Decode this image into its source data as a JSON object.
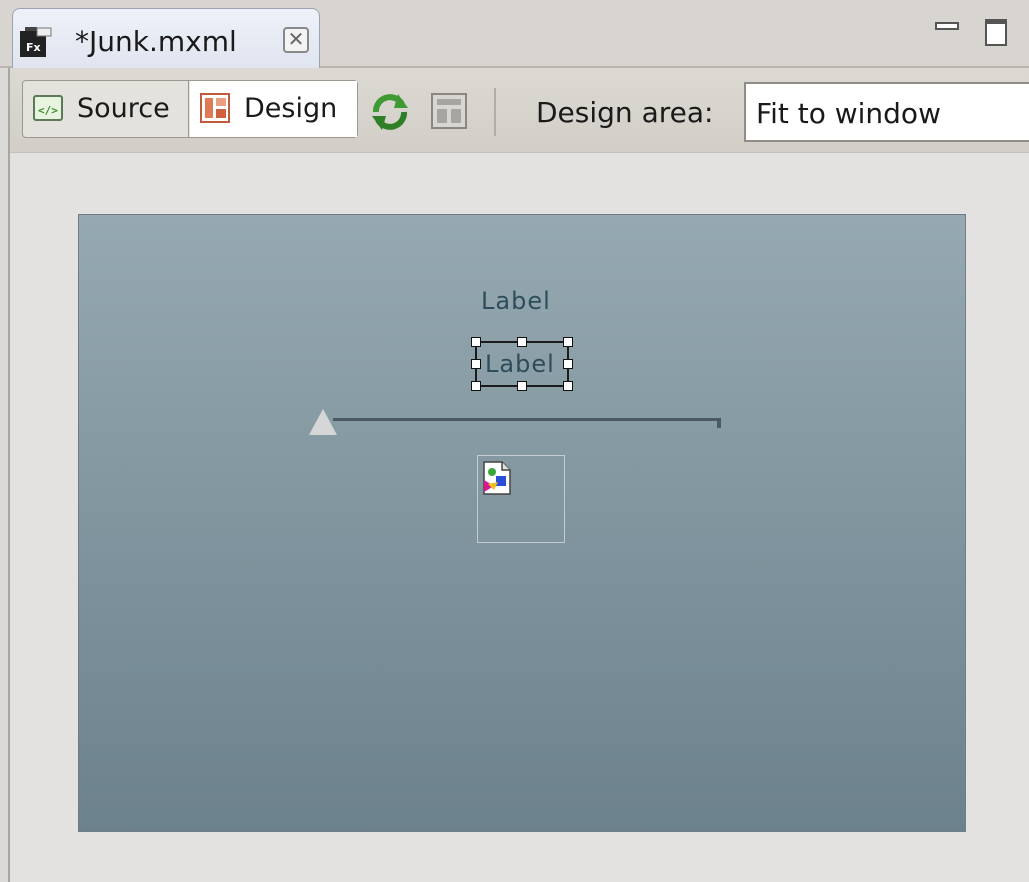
{
  "editor_tab": {
    "title": "*Junk.mxml",
    "icon": "fx-file-icon",
    "close_icon": "close-icon"
  },
  "window_controls": {
    "minimize_icon": "minimize-icon",
    "maximize_icon": "maximize-icon"
  },
  "toolbar": {
    "source_label": "Source",
    "design_label": "Design",
    "active_mode": "Design",
    "refresh_icon": "refresh-icon",
    "layout_icon": "layout-icon",
    "design_area_label": "Design area:",
    "design_area_value": "Fit to window"
  },
  "canvas": {
    "label_1": "Label",
    "label_2": "Label",
    "selected_component": "Label",
    "slider_value": 0,
    "image_icon": "broken-image-icon"
  },
  "colors": {
    "tab_active": "#dfe4ef",
    "stage_top": "#96a9b1",
    "stage_bottom": "#6b818c",
    "label_text": "#2e4d5a"
  }
}
